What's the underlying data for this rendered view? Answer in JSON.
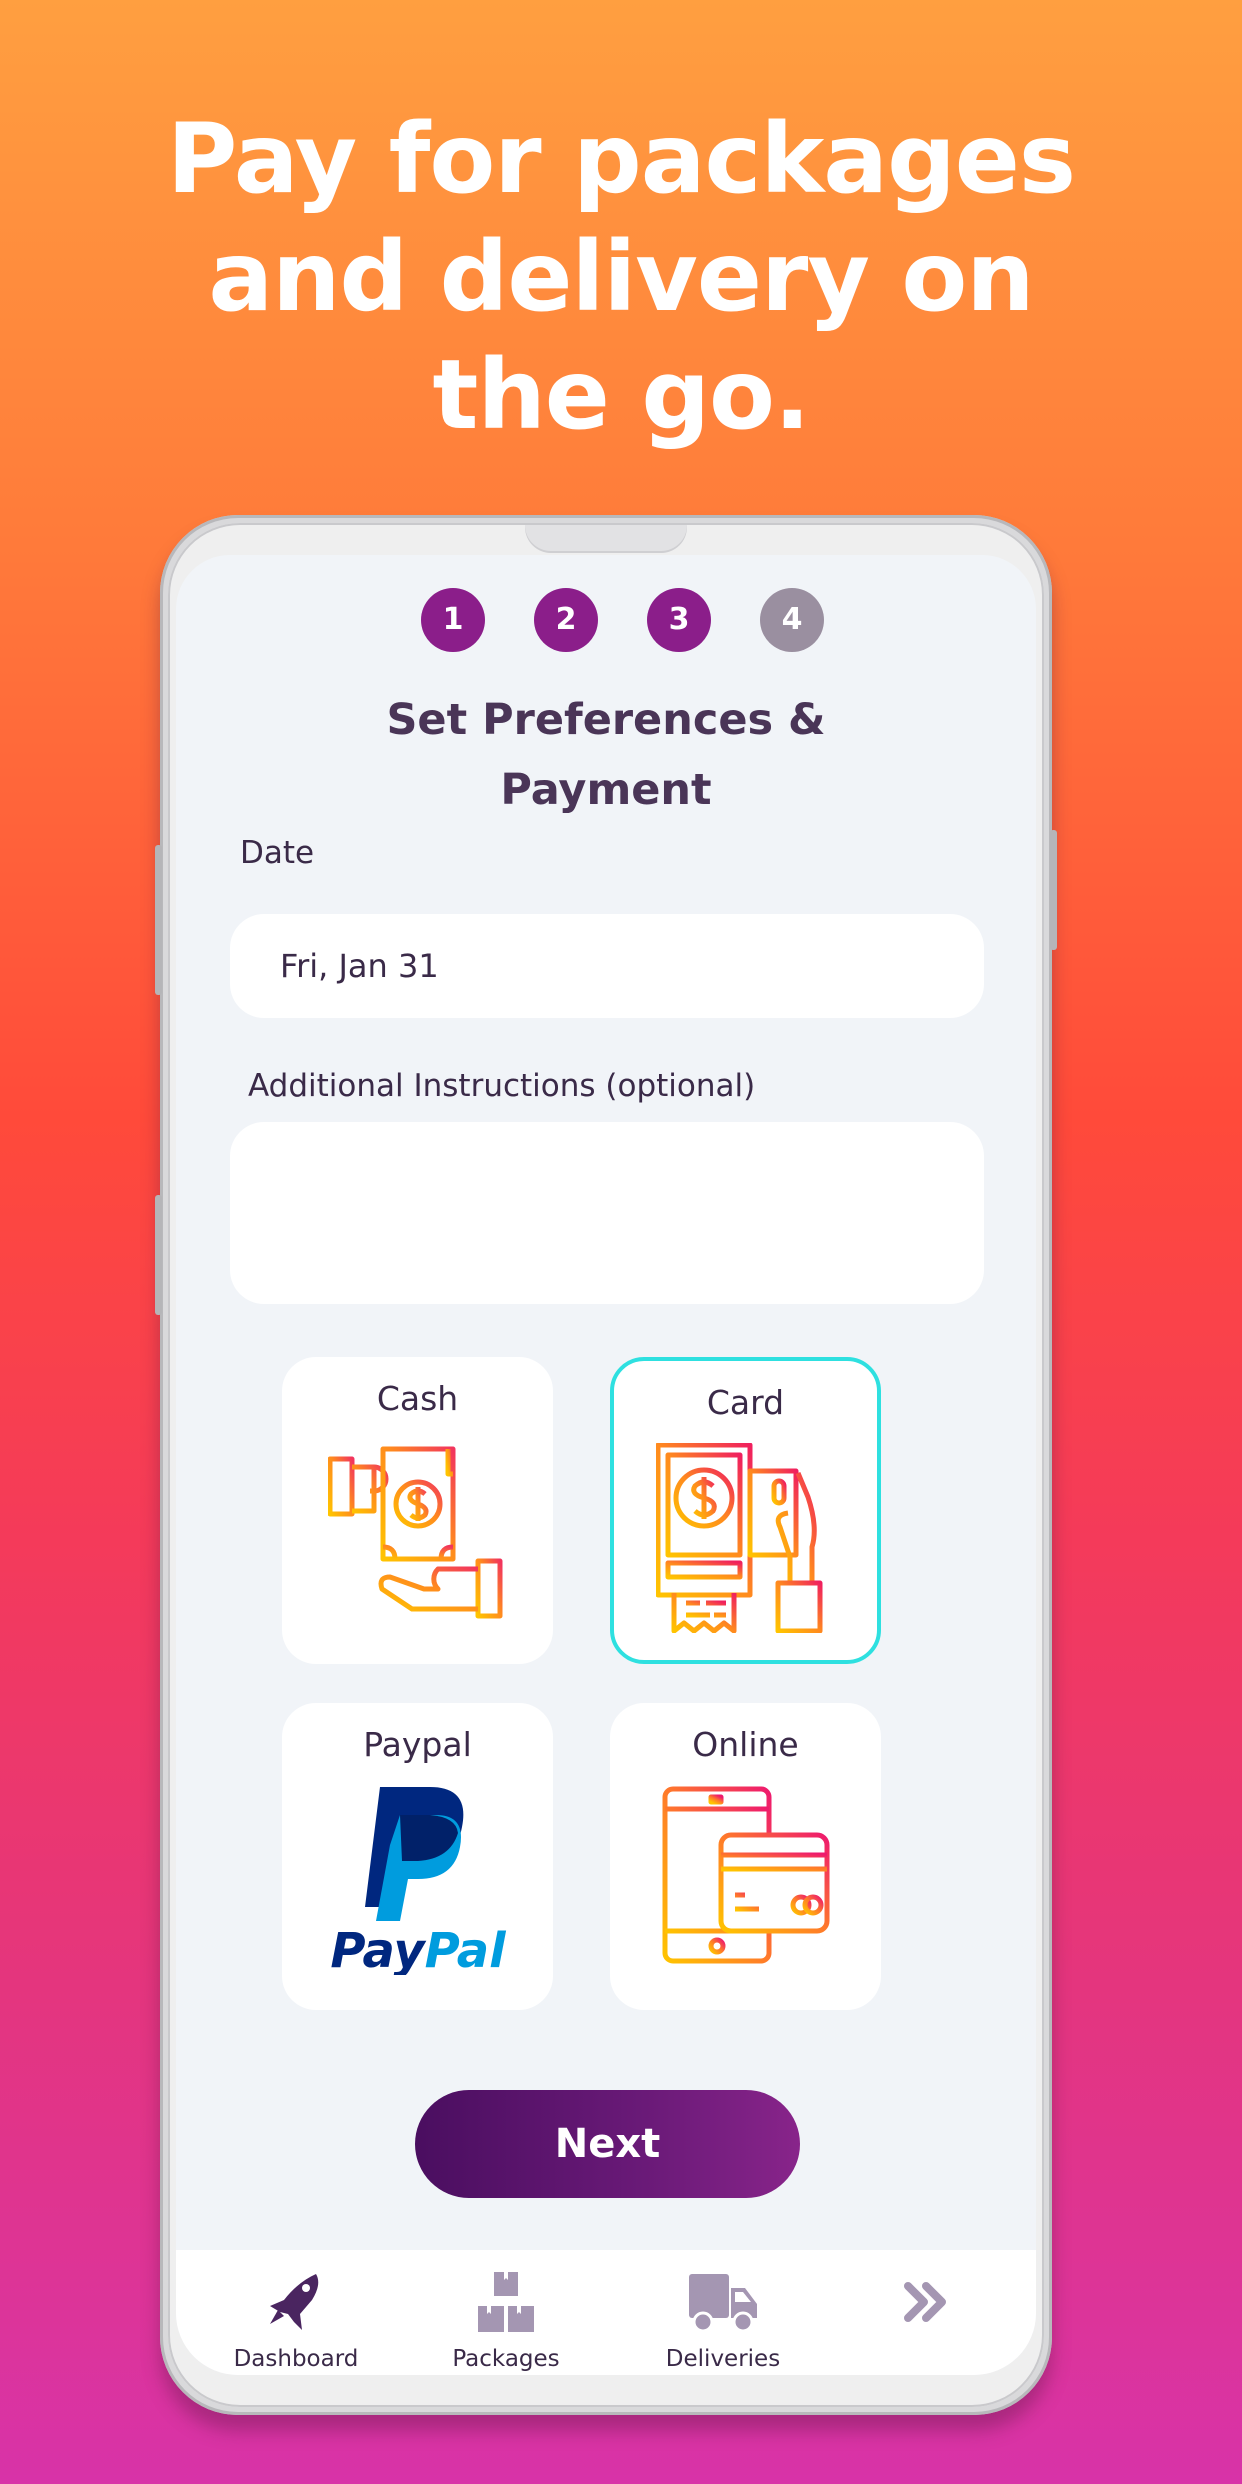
{
  "headline": {
    "lines": [
      "Pay for packages",
      "and delivery on",
      "the go."
    ]
  },
  "steps": [
    {
      "number": "1",
      "state": "complete",
      "color": "#8b1e8a"
    },
    {
      "number": "2",
      "state": "complete",
      "color": "#8b1e8a"
    },
    {
      "number": "3",
      "state": "current",
      "color": "#8b1e8a"
    },
    {
      "number": "4",
      "state": "pending",
      "color": "#9a8fa0"
    }
  ],
  "page": {
    "title_line1": "Set Preferences &",
    "title_line2": "Payment"
  },
  "form": {
    "date_label": "Date",
    "date_value": "Fri, Jan 31",
    "instructions_label": "Additional Instructions (optional)",
    "instructions_value": "",
    "instructions_placeholder": ""
  },
  "payment_methods": [
    {
      "label": "Cash",
      "icon": "cash-hands-icon",
      "selected": false
    },
    {
      "label": "Card",
      "icon": "card-terminal-icon",
      "selected": true
    },
    {
      "label": "Paypal",
      "icon": "paypal-logo-icon",
      "selected": false,
      "logo_text_dark": "Pay",
      "logo_text_light": "Pal"
    },
    {
      "label": "Online",
      "icon": "phone-card-icon",
      "selected": false
    }
  ],
  "actions": {
    "next_label": "Next"
  },
  "bottom_nav": [
    {
      "label": "Dashboard",
      "icon": "rocket-icon",
      "active": true
    },
    {
      "label": "Packages",
      "icon": "boxes-icon",
      "active": false
    },
    {
      "label": "Deliveries",
      "icon": "truck-icon",
      "active": false
    },
    {
      "label": "",
      "icon": "chevron-double-right-icon",
      "active": false
    }
  ],
  "colors": {
    "accent_purple": "#8b1e8a",
    "text_dark": "#3a2a48",
    "selected_border": "#2ee0e0",
    "nav_inactive": "#a496b2",
    "nav_active": "#4a2560"
  }
}
